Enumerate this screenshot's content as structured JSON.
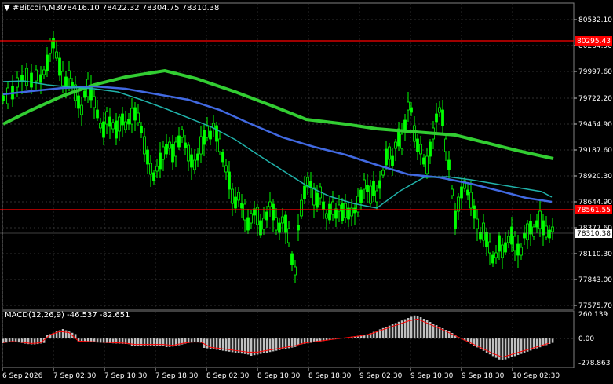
{
  "header": {
    "symbol": "#Bitcoin,M30",
    "ohlc": "78416.10 78422.32 78304.75 78310.38"
  },
  "price_axis": {
    "ticks": [
      "80532.10",
      "80264.90",
      "79997.60",
      "79722.20",
      "79454.90",
      "79187.60",
      "78920.30",
      "78644.90",
      "78377.60",
      "78110.30",
      "77843.00",
      "77575.70"
    ]
  },
  "price_labels": {
    "upper_line": "80295.43",
    "lower_line": "78561.55",
    "current": "78310.38"
  },
  "time_axis": {
    "ticks": [
      "6 Sep 2026",
      "7 Sep 02:30",
      "7 Sep 10:30",
      "7 Sep 18:30",
      "8 Sep 02:30",
      "8 Sep 10:30",
      "8 Sep 18:30",
      "9 Sep 02:30",
      "9 Sep 10:30",
      "9 Sep 18:30",
      "10 Sep 02:30"
    ]
  },
  "macd": {
    "label": "MACD(12,26,9) -46.537 -82.651",
    "ticks": [
      "260.139",
      "0.00",
      "-278.863"
    ]
  },
  "colors": {
    "background": "#000000",
    "candle_up": "#00ff00",
    "candle_down": "#00ff00",
    "ma_slow": "#32cd32",
    "ma_mid": "#4169e1",
    "ma_fast": "#20b2aa",
    "hline": "#ff0000",
    "macd_hist": "#c0c0c0",
    "macd_signal": "#ff0000"
  },
  "chart_data": {
    "type": "candlestick",
    "symbol": "#Bitcoin",
    "timeframe": "M30",
    "current_price": 78310.38,
    "horizontal_lines": [
      80295.43,
      78561.55
    ],
    "ylim": [
      77575.7,
      80532.1
    ]
  }
}
